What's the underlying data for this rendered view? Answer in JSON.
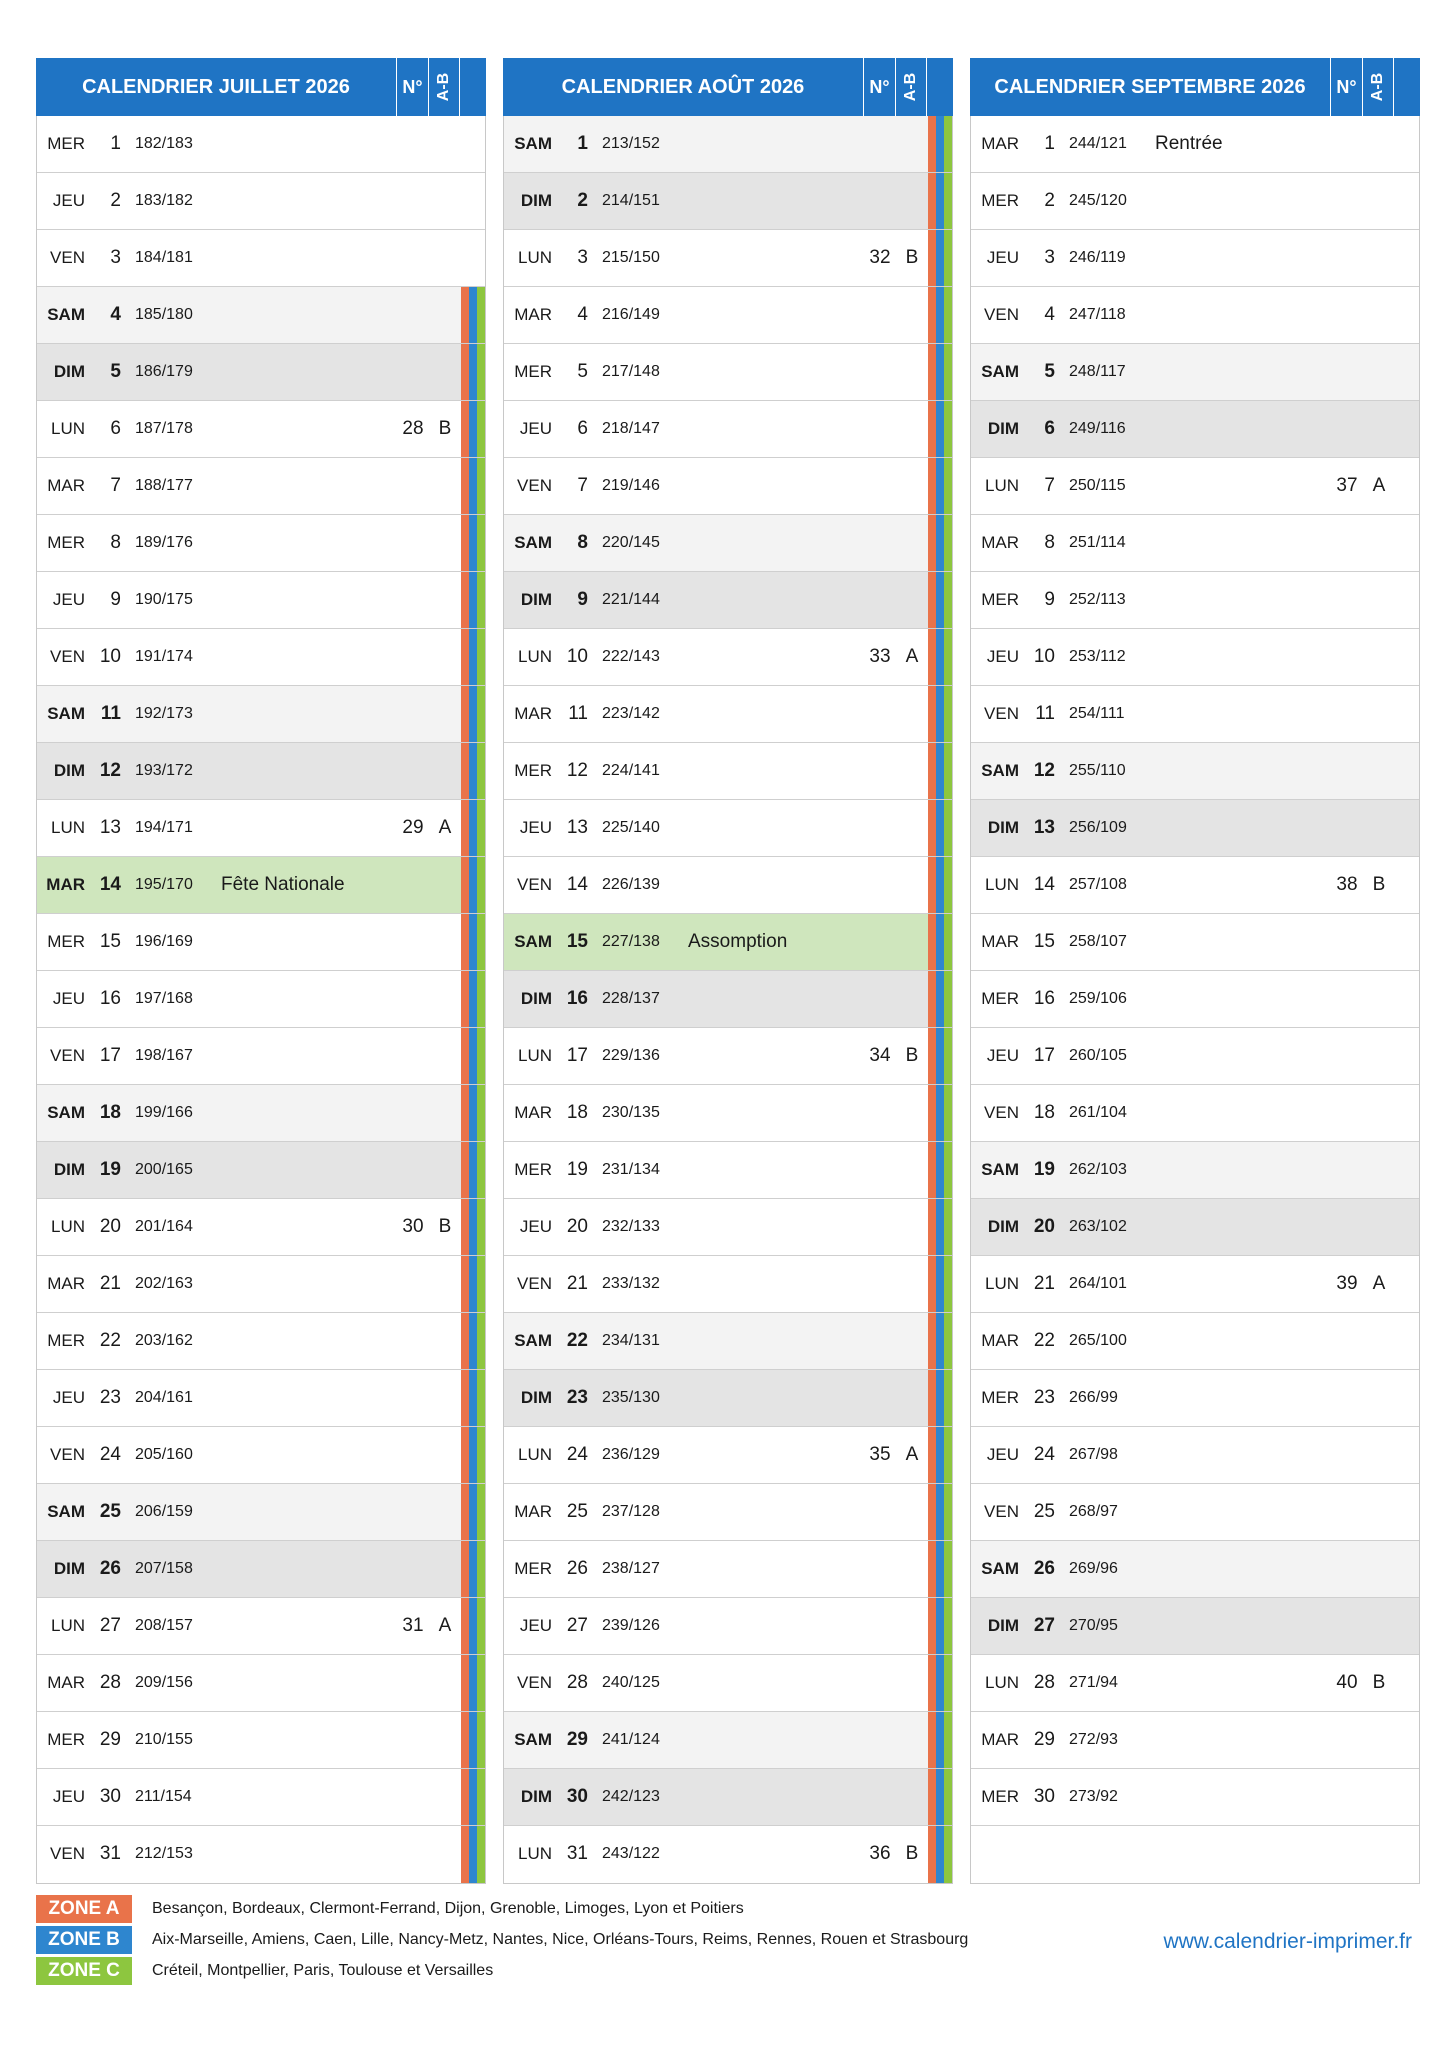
{
  "colors": {
    "header": "#1f74c4",
    "zone_a": "#e9734a",
    "zone_b": "#2e86cf",
    "zone_c": "#8dc63f",
    "holiday": "#cfe6bd",
    "saturday": "#f3f3f3",
    "sunday": "#e4e4e4"
  },
  "months": [
    {
      "title": "CALENDRIER JUILLET 2026",
      "no_label": "N°",
      "ab_label": "A-B",
      "days": [
        {
          "dow": "MER",
          "num": "1",
          "dy": "182/183",
          "zones": []
        },
        {
          "dow": "JEU",
          "num": "2",
          "dy": "183/182",
          "zones": []
        },
        {
          "dow": "VEN",
          "num": "3",
          "dy": "184/181",
          "zones": []
        },
        {
          "dow": "SAM",
          "num": "4",
          "dy": "185/180",
          "type": "sat",
          "zones": [
            "a",
            "b",
            "c"
          ]
        },
        {
          "dow": "DIM",
          "num": "5",
          "dy": "186/179",
          "type": "sun",
          "zones": [
            "a",
            "b",
            "c"
          ]
        },
        {
          "dow": "LUN",
          "num": "6",
          "dy": "187/178",
          "week": "28",
          "ab": "B",
          "zones": [
            "a",
            "b",
            "c"
          ]
        },
        {
          "dow": "MAR",
          "num": "7",
          "dy": "188/177",
          "zones": [
            "a",
            "b",
            "c"
          ]
        },
        {
          "dow": "MER",
          "num": "8",
          "dy": "189/176",
          "zones": [
            "a",
            "b",
            "c"
          ]
        },
        {
          "dow": "JEU",
          "num": "9",
          "dy": "190/175",
          "zones": [
            "a",
            "b",
            "c"
          ]
        },
        {
          "dow": "VEN",
          "num": "10",
          "dy": "191/174",
          "zones": [
            "a",
            "b",
            "c"
          ]
        },
        {
          "dow": "SAM",
          "num": "11",
          "dy": "192/173",
          "type": "sat",
          "zones": [
            "a",
            "b",
            "c"
          ]
        },
        {
          "dow": "DIM",
          "num": "12",
          "dy": "193/172",
          "type": "sun",
          "zones": [
            "a",
            "b",
            "c"
          ]
        },
        {
          "dow": "LUN",
          "num": "13",
          "dy": "194/171",
          "week": "29",
          "ab": "A",
          "zones": [
            "a",
            "b",
            "c"
          ]
        },
        {
          "dow": "MAR",
          "num": "14",
          "dy": "195/170",
          "event": "Fête Nationale",
          "type": "holiday",
          "bold": true,
          "zones": [
            "a",
            "b",
            "c"
          ]
        },
        {
          "dow": "MER",
          "num": "15",
          "dy": "196/169",
          "zones": [
            "a",
            "b",
            "c"
          ]
        },
        {
          "dow": "JEU",
          "num": "16",
          "dy": "197/168",
          "zones": [
            "a",
            "b",
            "c"
          ]
        },
        {
          "dow": "VEN",
          "num": "17",
          "dy": "198/167",
          "zones": [
            "a",
            "b",
            "c"
          ]
        },
        {
          "dow": "SAM",
          "num": "18",
          "dy": "199/166",
          "type": "sat",
          "zones": [
            "a",
            "b",
            "c"
          ]
        },
        {
          "dow": "DIM",
          "num": "19",
          "dy": "200/165",
          "type": "sun",
          "zones": [
            "a",
            "b",
            "c"
          ]
        },
        {
          "dow": "LUN",
          "num": "20",
          "dy": "201/164",
          "week": "30",
          "ab": "B",
          "zones": [
            "a",
            "b",
            "c"
          ]
        },
        {
          "dow": "MAR",
          "num": "21",
          "dy": "202/163",
          "zones": [
            "a",
            "b",
            "c"
          ]
        },
        {
          "dow": "MER",
          "num": "22",
          "dy": "203/162",
          "zones": [
            "a",
            "b",
            "c"
          ]
        },
        {
          "dow": "JEU",
          "num": "23",
          "dy": "204/161",
          "zones": [
            "a",
            "b",
            "c"
          ]
        },
        {
          "dow": "VEN",
          "num": "24",
          "dy": "205/160",
          "zones": [
            "a",
            "b",
            "c"
          ]
        },
        {
          "dow": "SAM",
          "num": "25",
          "dy": "206/159",
          "type": "sat",
          "zones": [
            "a",
            "b",
            "c"
          ]
        },
        {
          "dow": "DIM",
          "num": "26",
          "dy": "207/158",
          "type": "sun",
          "zones": [
            "a",
            "b",
            "c"
          ]
        },
        {
          "dow": "LUN",
          "num": "27",
          "dy": "208/157",
          "week": "31",
          "ab": "A",
          "zones": [
            "a",
            "b",
            "c"
          ]
        },
        {
          "dow": "MAR",
          "num": "28",
          "dy": "209/156",
          "zones": [
            "a",
            "b",
            "c"
          ]
        },
        {
          "dow": "MER",
          "num": "29",
          "dy": "210/155",
          "zones": [
            "a",
            "b",
            "c"
          ]
        },
        {
          "dow": "JEU",
          "num": "30",
          "dy": "211/154",
          "zones": [
            "a",
            "b",
            "c"
          ]
        },
        {
          "dow": "VEN",
          "num": "31",
          "dy": "212/153",
          "zones": [
            "a",
            "b",
            "c"
          ]
        }
      ]
    },
    {
      "title": "CALENDRIER AOÛT 2026",
      "no_label": "N°",
      "ab_label": "A-B",
      "days": [
        {
          "dow": "SAM",
          "num": "1",
          "dy": "213/152",
          "type": "sat",
          "zones": [
            "a",
            "b",
            "c"
          ]
        },
        {
          "dow": "DIM",
          "num": "2",
          "dy": "214/151",
          "type": "sun",
          "zones": [
            "a",
            "b",
            "c"
          ]
        },
        {
          "dow": "LUN",
          "num": "3",
          "dy": "215/150",
          "week": "32",
          "ab": "B",
          "zones": [
            "a",
            "b",
            "c"
          ]
        },
        {
          "dow": "MAR",
          "num": "4",
          "dy": "216/149",
          "zones": [
            "a",
            "b",
            "c"
          ]
        },
        {
          "dow": "MER",
          "num": "5",
          "dy": "217/148",
          "zones": [
            "a",
            "b",
            "c"
          ]
        },
        {
          "dow": "JEU",
          "num": "6",
          "dy": "218/147",
          "zones": [
            "a",
            "b",
            "c"
          ]
        },
        {
          "dow": "VEN",
          "num": "7",
          "dy": "219/146",
          "zones": [
            "a",
            "b",
            "c"
          ]
        },
        {
          "dow": "SAM",
          "num": "8",
          "dy": "220/145",
          "type": "sat",
          "zones": [
            "a",
            "b",
            "c"
          ]
        },
        {
          "dow": "DIM",
          "num": "9",
          "dy": "221/144",
          "type": "sun",
          "zones": [
            "a",
            "b",
            "c"
          ]
        },
        {
          "dow": "LUN",
          "num": "10",
          "dy": "222/143",
          "week": "33",
          "ab": "A",
          "zones": [
            "a",
            "b",
            "c"
          ]
        },
        {
          "dow": "MAR",
          "num": "11",
          "dy": "223/142",
          "zones": [
            "a",
            "b",
            "c"
          ]
        },
        {
          "dow": "MER",
          "num": "12",
          "dy": "224/141",
          "zones": [
            "a",
            "b",
            "c"
          ]
        },
        {
          "dow": "JEU",
          "num": "13",
          "dy": "225/140",
          "zones": [
            "a",
            "b",
            "c"
          ]
        },
        {
          "dow": "VEN",
          "num": "14",
          "dy": "226/139",
          "zones": [
            "a",
            "b",
            "c"
          ]
        },
        {
          "dow": "SAM",
          "num": "15",
          "dy": "227/138",
          "event": "Assomption",
          "type": "holiday",
          "bold": true,
          "zones": [
            "a",
            "b",
            "c"
          ]
        },
        {
          "dow": "DIM",
          "num": "16",
          "dy": "228/137",
          "type": "sun",
          "zones": [
            "a",
            "b",
            "c"
          ]
        },
        {
          "dow": "LUN",
          "num": "17",
          "dy": "229/136",
          "week": "34",
          "ab": "B",
          "zones": [
            "a",
            "b",
            "c"
          ]
        },
        {
          "dow": "MAR",
          "num": "18",
          "dy": "230/135",
          "zones": [
            "a",
            "b",
            "c"
          ]
        },
        {
          "dow": "MER",
          "num": "19",
          "dy": "231/134",
          "zones": [
            "a",
            "b",
            "c"
          ]
        },
        {
          "dow": "JEU",
          "num": "20",
          "dy": "232/133",
          "zones": [
            "a",
            "b",
            "c"
          ]
        },
        {
          "dow": "VEN",
          "num": "21",
          "dy": "233/132",
          "zones": [
            "a",
            "b",
            "c"
          ]
        },
        {
          "dow": "SAM",
          "num": "22",
          "dy": "234/131",
          "type": "sat",
          "zones": [
            "a",
            "b",
            "c"
          ]
        },
        {
          "dow": "DIM",
          "num": "23",
          "dy": "235/130",
          "type": "sun",
          "zones": [
            "a",
            "b",
            "c"
          ]
        },
        {
          "dow": "LUN",
          "num": "24",
          "dy": "236/129",
          "week": "35",
          "ab": "A",
          "zones": [
            "a",
            "b",
            "c"
          ]
        },
        {
          "dow": "MAR",
          "num": "25",
          "dy": "237/128",
          "zones": [
            "a",
            "b",
            "c"
          ]
        },
        {
          "dow": "MER",
          "num": "26",
          "dy": "238/127",
          "zones": [
            "a",
            "b",
            "c"
          ]
        },
        {
          "dow": "JEU",
          "num": "27",
          "dy": "239/126",
          "zones": [
            "a",
            "b",
            "c"
          ]
        },
        {
          "dow": "VEN",
          "num": "28",
          "dy": "240/125",
          "zones": [
            "a",
            "b",
            "c"
          ]
        },
        {
          "dow": "SAM",
          "num": "29",
          "dy": "241/124",
          "type": "sat",
          "zones": [
            "a",
            "b",
            "c"
          ]
        },
        {
          "dow": "DIM",
          "num": "30",
          "dy": "242/123",
          "type": "sun",
          "zones": [
            "a",
            "b",
            "c"
          ]
        },
        {
          "dow": "LUN",
          "num": "31",
          "dy": "243/122",
          "week": "36",
          "ab": "B",
          "zones": [
            "a",
            "b",
            "c"
          ]
        }
      ]
    },
    {
      "title": "CALENDRIER SEPTEMBRE 2026",
      "no_label": "N°",
      "ab_label": "A-B",
      "days": [
        {
          "dow": "MAR",
          "num": "1",
          "dy": "244/121",
          "event": "Rentrée",
          "zones": []
        },
        {
          "dow": "MER",
          "num": "2",
          "dy": "245/120",
          "zones": []
        },
        {
          "dow": "JEU",
          "num": "3",
          "dy": "246/119",
          "zones": []
        },
        {
          "dow": "VEN",
          "num": "4",
          "dy": "247/118",
          "zones": []
        },
        {
          "dow": "SAM",
          "num": "5",
          "dy": "248/117",
          "type": "sat",
          "zones": []
        },
        {
          "dow": "DIM",
          "num": "6",
          "dy": "249/116",
          "type": "sun",
          "zones": []
        },
        {
          "dow": "LUN",
          "num": "7",
          "dy": "250/115",
          "week": "37",
          "ab": "A",
          "zones": []
        },
        {
          "dow": "MAR",
          "num": "8",
          "dy": "251/114",
          "zones": []
        },
        {
          "dow": "MER",
          "num": "9",
          "dy": "252/113",
          "zones": []
        },
        {
          "dow": "JEU",
          "num": "10",
          "dy": "253/112",
          "zones": []
        },
        {
          "dow": "VEN",
          "num": "11",
          "dy": "254/111",
          "zones": []
        },
        {
          "dow": "SAM",
          "num": "12",
          "dy": "255/110",
          "type": "sat",
          "zones": []
        },
        {
          "dow": "DIM",
          "num": "13",
          "dy": "256/109",
          "type": "sun",
          "zones": []
        },
        {
          "dow": "LUN",
          "num": "14",
          "dy": "257/108",
          "week": "38",
          "ab": "B",
          "zones": []
        },
        {
          "dow": "MAR",
          "num": "15",
          "dy": "258/107",
          "zones": []
        },
        {
          "dow": "MER",
          "num": "16",
          "dy": "259/106",
          "zones": []
        },
        {
          "dow": "JEU",
          "num": "17",
          "dy": "260/105",
          "zones": []
        },
        {
          "dow": "VEN",
          "num": "18",
          "dy": "261/104",
          "zones": []
        },
        {
          "dow": "SAM",
          "num": "19",
          "dy": "262/103",
          "type": "sat",
          "zones": []
        },
        {
          "dow": "DIM",
          "num": "20",
          "dy": "263/102",
          "type": "sun",
          "zones": []
        },
        {
          "dow": "LUN",
          "num": "21",
          "dy": "264/101",
          "week": "39",
          "ab": "A",
          "zones": []
        },
        {
          "dow": "MAR",
          "num": "22",
          "dy": "265/100",
          "zones": []
        },
        {
          "dow": "MER",
          "num": "23",
          "dy": "266/99",
          "zones": []
        },
        {
          "dow": "JEU",
          "num": "24",
          "dy": "267/98",
          "zones": []
        },
        {
          "dow": "VEN",
          "num": "25",
          "dy": "268/97",
          "zones": []
        },
        {
          "dow": "SAM",
          "num": "26",
          "dy": "269/96",
          "type": "sat",
          "zones": []
        },
        {
          "dow": "DIM",
          "num": "27",
          "dy": "270/95",
          "type": "sun",
          "zones": []
        },
        {
          "dow": "LUN",
          "num": "28",
          "dy": "271/94",
          "week": "40",
          "ab": "B",
          "zones": []
        },
        {
          "dow": "MAR",
          "num": "29",
          "dy": "272/93",
          "zones": []
        },
        {
          "dow": "MER",
          "num": "30",
          "dy": "273/92",
          "zones": []
        },
        {
          "empty": true
        }
      ]
    }
  ],
  "legend": [
    {
      "label": "ZONE A",
      "color": "#e9734a",
      "text": "Besançon, Bordeaux, Clermont-Ferrand, Dijon, Grenoble, Limoges, Lyon et Poitiers"
    },
    {
      "label": "ZONE B",
      "color": "#2e86cf",
      "text": "Aix-Marseille, Amiens, Caen, Lille, Nancy-Metz, Nantes, Nice, Orléans-Tours, Reims, Rennes, Rouen et Strasbourg"
    },
    {
      "label": "ZONE C",
      "color": "#8dc63f",
      "text": "Créteil, Montpellier, Paris, Toulouse et Versailles"
    }
  ],
  "website": "www.calendrier-imprimer.fr"
}
